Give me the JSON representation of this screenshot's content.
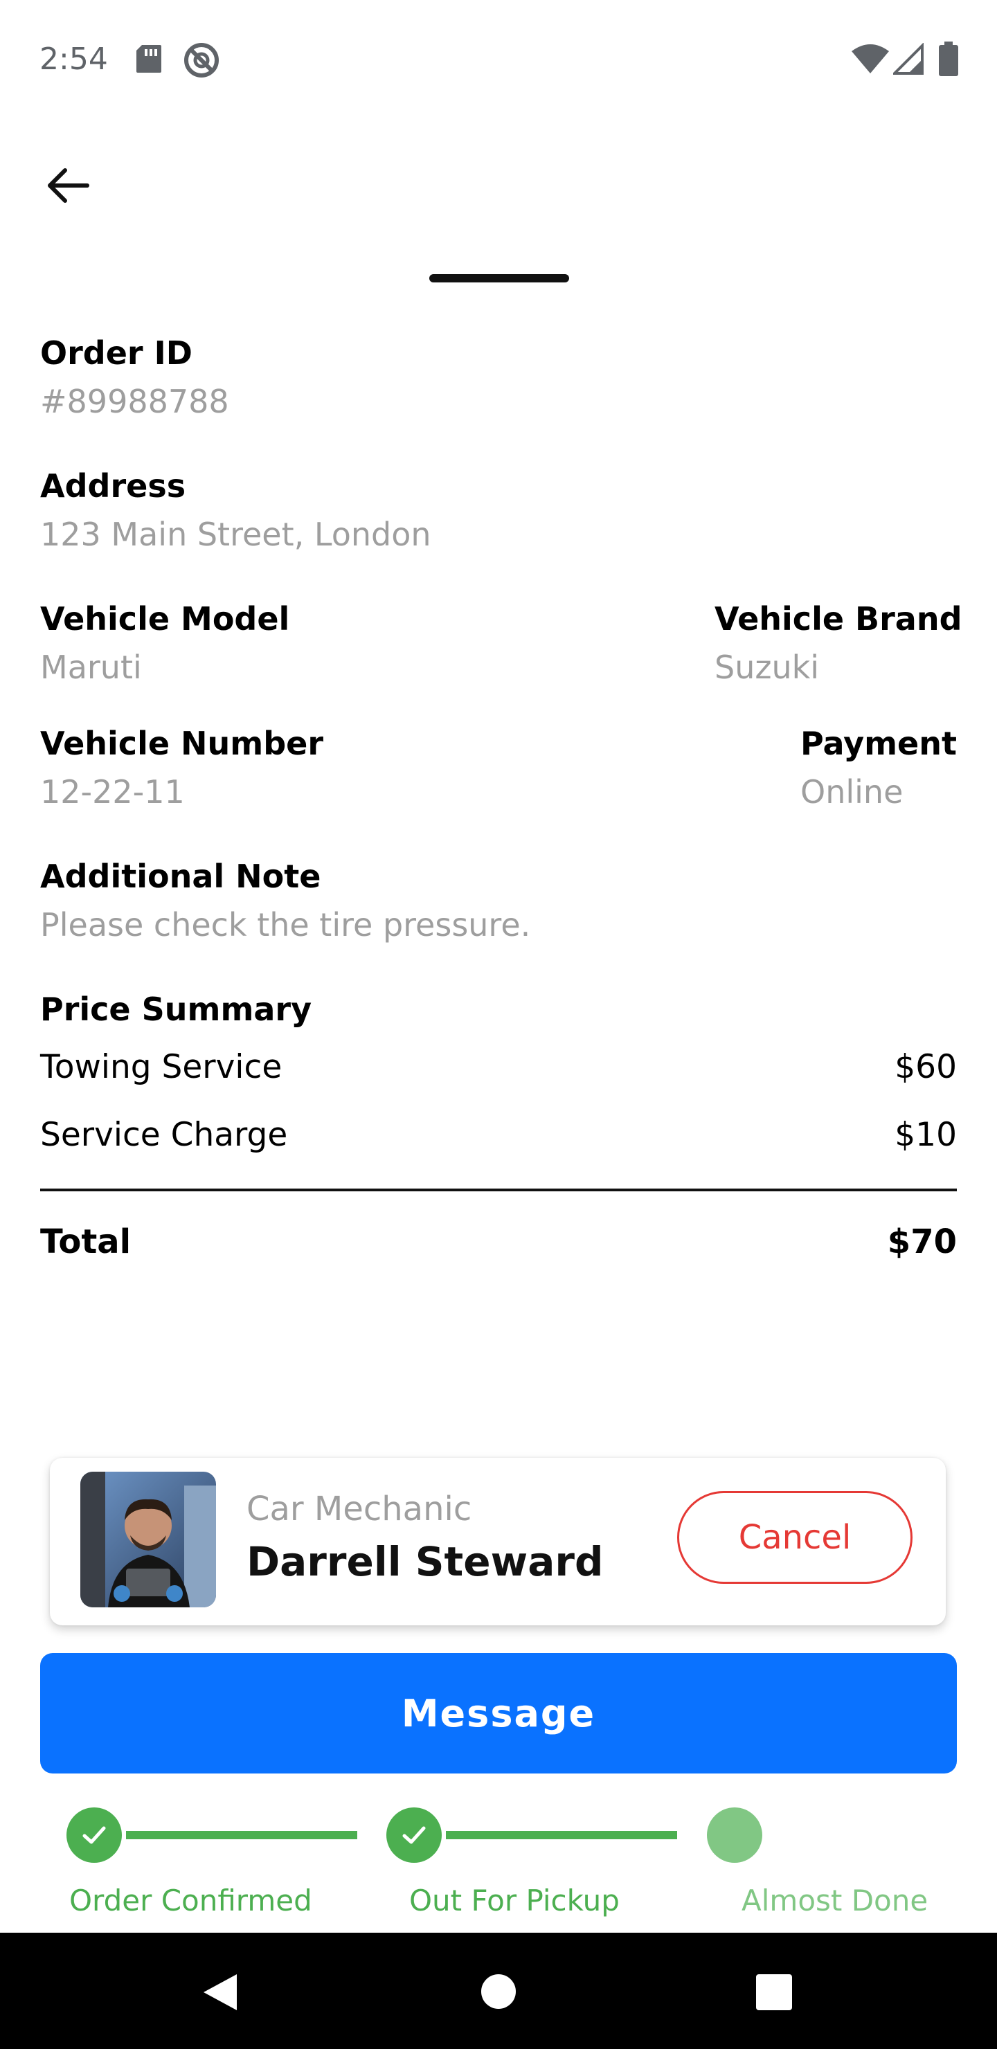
{
  "status_bar": {
    "time": "2:54",
    "icons": [
      "sd-card-icon",
      "no-sync-icon",
      "wifi-icon",
      "signal-icon",
      "battery-icon"
    ]
  },
  "header": {
    "back_icon": "arrow-left-icon"
  },
  "order": {
    "id_label": "Order ID",
    "id_value": "#89988788",
    "address_label": "Address",
    "address_value": "123 Main Street, London",
    "vehicle_model_label": "Vehicle Model",
    "vehicle_model_value": "Maruti",
    "vehicle_brand_label": "Vehicle Brand",
    "vehicle_brand_value": "Suzuki",
    "vehicle_number_label": "Vehicle Number",
    "vehicle_number_value": "12-22-11",
    "payment_label": "Payment",
    "payment_value": "Online",
    "note_label": "Additional Note",
    "note_value": "Please check the tire pressure."
  },
  "price_summary": {
    "title": "Price Summary",
    "items": [
      {
        "name": "Towing Service",
        "amount": "$60"
      },
      {
        "name": "Service Charge",
        "amount": "$10"
      }
    ],
    "total_label": "Total",
    "total_amount": "$70"
  },
  "mechanic": {
    "role": "Car Mechanic",
    "name": "Darrell Steward",
    "cancel_label": "Cancel"
  },
  "message_label": "Message",
  "progress": {
    "steps": [
      {
        "label": "Order Confirmed",
        "state": "done"
      },
      {
        "label": "Out For Pickup",
        "state": "done"
      },
      {
        "label": "Almost Done",
        "state": "pending"
      }
    ]
  },
  "colors": {
    "primary": "#0a72ff",
    "danger": "#e53935",
    "success": "#4caf50",
    "muted_text": "#9e9e9e"
  }
}
